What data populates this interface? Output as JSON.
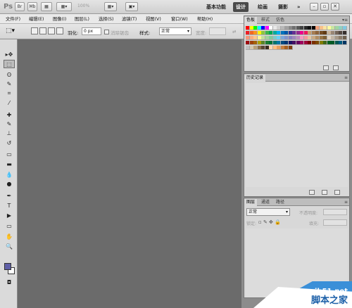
{
  "titlebar": {
    "app_logo": "Ps",
    "btn_br": "Br",
    "btn_mb": "Mb",
    "zoom": "100%",
    "workspaces": [
      "基本功能",
      "设计",
      "绘画",
      "摄影"
    ],
    "more": "»",
    "controls": [
      "–",
      "▫",
      "✕"
    ]
  },
  "menubar": {
    "items": [
      "文件(F)",
      "编辑(E)",
      "图像(I)",
      "图层(L)",
      "选择(S)",
      "滤镜(T)",
      "视图(V)",
      "窗口(W)",
      "帮助(H)"
    ]
  },
  "options": {
    "feather_label": "羽化:",
    "feather_value": "0 px",
    "antialias_label": "消除锯齿",
    "style_label": "样式:",
    "style_value": "正常",
    "width_label": "宽度:"
  },
  "tools": {
    "icons": [
      "move-icon",
      "marquee-icon",
      "lasso-icon",
      "quick-select-icon",
      "crop-icon",
      "eyedropper-icon",
      "healing-brush-icon",
      "brush-icon",
      "clone-stamp-icon",
      "history-brush-icon",
      "eraser-icon",
      "gradient-icon",
      "blur-icon",
      "dodge-icon",
      "pen-icon",
      "type-icon",
      "path-select-icon",
      "shape-icon",
      "hand-icon",
      "zoom-icon"
    ],
    "glyphs": [
      "▸✥",
      "⬚",
      "ʘ",
      "✎",
      "⌗",
      "⁄",
      "✚",
      "✎",
      "⊥",
      "↺",
      "▭",
      "▬",
      "💧",
      "●",
      "✒",
      "T",
      "▶",
      "▭",
      "✋",
      "🔍"
    ],
    "foreground_color": "#5f5fa7",
    "background_color": "#ffffff"
  },
  "swatches_panel": {
    "tabs": [
      "色板",
      "样式",
      "仿色"
    ],
    "menu_glyph": "▾≡"
  },
  "history_panel": {
    "tabs": [
      "历史记录"
    ]
  },
  "layers_panel": {
    "tabs": [
      "图层",
      "通道",
      "路径"
    ],
    "blend_mode": "正常",
    "opacity_label": "不透明度:",
    "lock_label": "锁定:",
    "fill_label": "填充:"
  },
  "watermark": {
    "url": "jb51.net",
    "name": "脚本之家"
  }
}
